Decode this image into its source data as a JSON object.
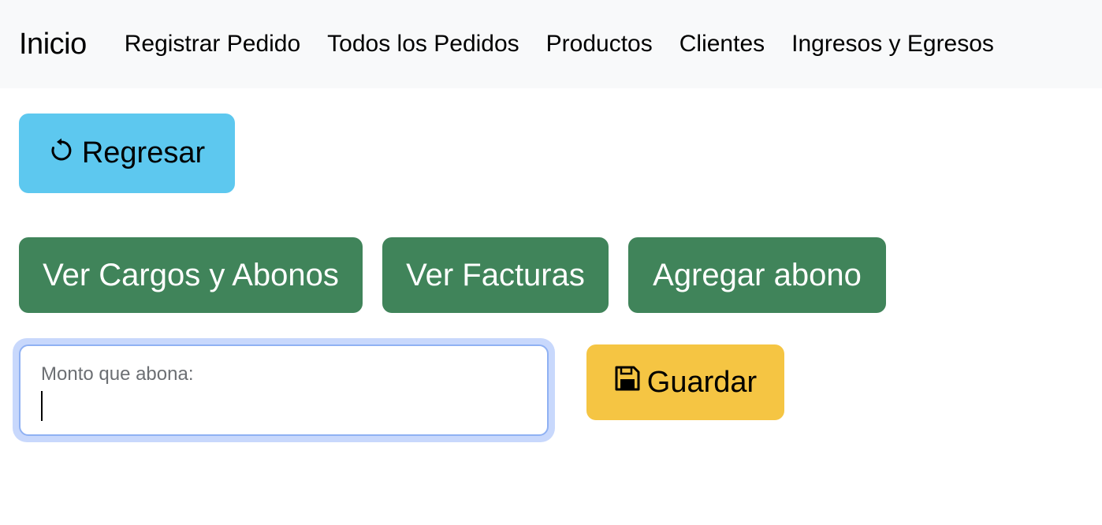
{
  "navbar": {
    "brand": "Inicio",
    "links": [
      {
        "label": "Registrar Pedido"
      },
      {
        "label": "Todos los Pedidos"
      },
      {
        "label": "Productos"
      },
      {
        "label": "Clientes"
      },
      {
        "label": "Ingresos y Egresos"
      }
    ]
  },
  "actions": {
    "back_label": "Regresar",
    "back_icon": "rotate-ccw-icon",
    "cargos_label": "Ver Cargos y Abonos",
    "facturas_label": "Ver Facturas",
    "abono_label": "Agregar abono"
  },
  "form": {
    "amount_label": "Monto que abona:",
    "amount_value": "",
    "save_label": "Guardar",
    "save_icon": "floppy-disk-icon"
  },
  "colors": {
    "navbar_bg": "#f8f9fa",
    "info": "#5dc8ef",
    "success": "#40845a",
    "warning": "#f5c543",
    "focus_ring": "#c8d8fc"
  }
}
